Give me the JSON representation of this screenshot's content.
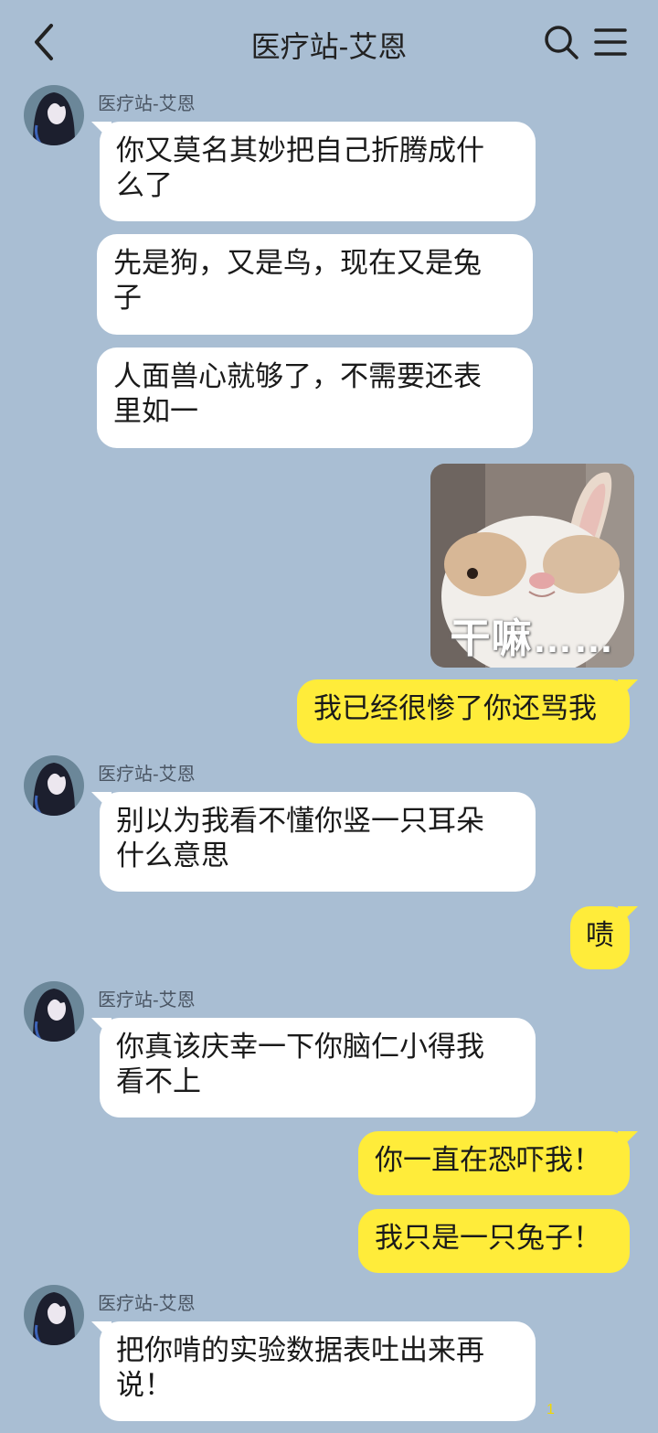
{
  "header": {
    "title": "医疗站-艾恩",
    "back_icon": "chevron-left-icon",
    "search_icon": "search-icon",
    "menu_icon": "hamburger-menu-icon"
  },
  "colors": {
    "background": "#a9bed3",
    "incoming_bubble": "#ffffff",
    "outgoing_bubble": "#ffec3a"
  },
  "messages": [
    {
      "sender": "医疗站-艾恩",
      "direction": "in",
      "line1": "你又莫名其妙把自己折腾成什",
      "line2": "么了"
    },
    {
      "direction": "in",
      "line1": "先是狗，又是鸟，现在又是兔",
      "line2": "子"
    },
    {
      "direction": "in",
      "line1": "人面兽心就够了，不需要还表",
      "line2": "里如一"
    },
    {
      "direction": "out",
      "type": "sticker",
      "caption": "干嘛……"
    },
    {
      "direction": "out",
      "text": "我已经很惨了你还骂我"
    },
    {
      "sender": "医疗站-艾恩",
      "direction": "in",
      "line1": "别以为我看不懂你竖一只耳朵",
      "line2": "什么意思"
    },
    {
      "direction": "out",
      "text": "啧"
    },
    {
      "sender": "医疗站-艾恩",
      "direction": "in",
      "line1": "你真该庆幸一下你脑仁小得我",
      "line2": "看不上"
    },
    {
      "direction": "out",
      "text": "你一直在恐吓我！"
    },
    {
      "direction": "out",
      "text": "我只是一只兔子！"
    },
    {
      "sender": "医疗站-艾恩",
      "direction": "in",
      "line1": "把你啃的实验数据表吐出来再",
      "line2": "说！"
    }
  ],
  "unread_count": "1"
}
